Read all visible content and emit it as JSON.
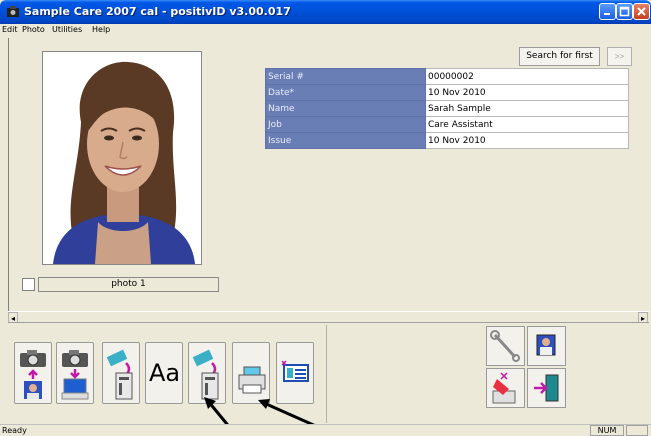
{
  "window": {
    "title": "Sample Care 2007 cal - positivID v3.00.017",
    "buttons": [
      "minimize-icon",
      "maximize-icon",
      "close-icon"
    ]
  },
  "menu": {
    "items": [
      "Edit",
      "Photo",
      "Utilities",
      "Help"
    ]
  },
  "photo": {
    "label": "photo 1",
    "checked": false
  },
  "search": {
    "button_label": "Search for first",
    "next_label": ">>"
  },
  "record": {
    "rows": [
      {
        "field": "Serial #",
        "value": "00000002"
      },
      {
        "field": "Date*",
        "value": "10 Nov 2010"
      },
      {
        "field": "Name",
        "value": "Sarah Sample"
      },
      {
        "field": "Job",
        "value": "Care Assistant"
      },
      {
        "field": "Issue",
        "value": "10 Nov 2010"
      }
    ]
  },
  "toolbar": {
    "buttons": [
      {
        "name": "camera-to-photo-icon"
      },
      {
        "name": "camera-to-computer-icon"
      },
      {
        "name": "edit-card-icon"
      },
      {
        "name": "font-icon",
        "label": "Aa"
      },
      {
        "name": "print-card-icon"
      },
      {
        "name": "printer-icon"
      },
      {
        "name": "card-layout-icon"
      }
    ],
    "right_buttons": [
      {
        "name": "settings-wrench-icon"
      },
      {
        "name": "user-icon"
      },
      {
        "name": "eraser-icon"
      },
      {
        "name": "exit-door-icon"
      }
    ]
  },
  "status": {
    "text": "Ready",
    "num": "NUM"
  },
  "colors": {
    "titlebar": "#0054e3",
    "grid_key_bg": "#6a7eb6",
    "window_bg": "#ece9d8"
  }
}
